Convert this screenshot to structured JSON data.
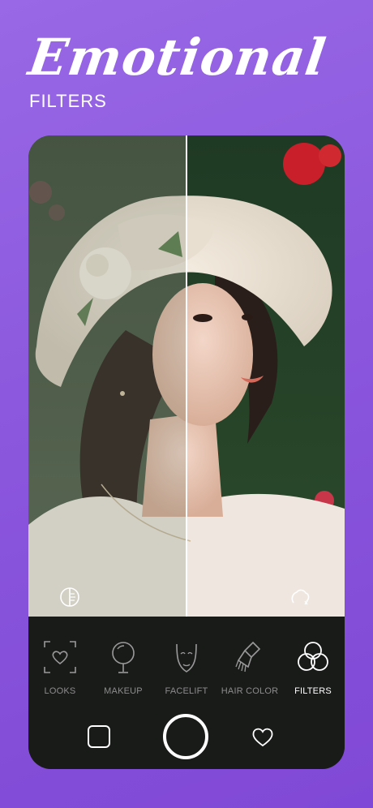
{
  "headline": {
    "script_title": "Emotional",
    "subtitle": "FILTERS"
  },
  "photo": {
    "description_icon_left": "compare-icon",
    "description_icon_right": "beautify-icon"
  },
  "toolbar": {
    "tabs": [
      {
        "label": "LOOKS",
        "icon": "face-frame-icon",
        "active": false
      },
      {
        "label": "MAKEUP",
        "icon": "mirror-icon",
        "active": false
      },
      {
        "label": "FACELIFT",
        "icon": "face-outline-icon",
        "active": false
      },
      {
        "label": "HAIR COLOR",
        "icon": "hair-brush-icon",
        "active": false
      },
      {
        "label": "FILTERS",
        "icon": "filters-circles-icon",
        "active": true
      }
    ]
  },
  "colors": {
    "background_top": "#9868e6",
    "background_bottom": "#8048d6",
    "toolbar_bg": "#181818",
    "active_label": "#ffffff",
    "inactive_label": "#8c8c8c"
  }
}
